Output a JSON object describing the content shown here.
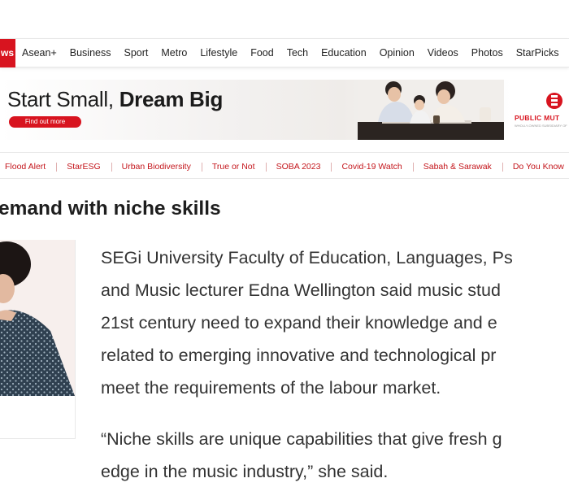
{
  "nav": {
    "logo_text": "ws",
    "items": [
      "Asean+",
      "Business",
      "Sport",
      "Metro",
      "Lifestyle",
      "Food",
      "Tech",
      "Education",
      "Opinion",
      "Videos",
      "Photos",
      "StarPicks"
    ]
  },
  "ad": {
    "headline_part1": "Start Small, ",
    "headline_part2": "Dream Big",
    "cta_label": "Find out more",
    "brand_name": "PUBLIC MUT",
    "brand_tagline": "WHOLLY-OWNED SUBSIDIARY OF",
    "brand_color": "#d8141f"
  },
  "topics": [
    "Flood Alert",
    "StarESG",
    "Urban Biodiversity",
    "True or Not",
    "SOBA 2023",
    "Covid-19 Watch",
    "Sabah & Sarawak",
    "Do You Know"
  ],
  "article": {
    "title": "emand with niche skills",
    "paragraph1": [
      "SEGi University Faculty of Education, Languages, Ps",
      "and Music lecturer Edna Wellington said music stud",
      "21st century need to expand their knowledge and e",
      "related to emerging innovative and technological pr",
      "meet the requirements of the labour market."
    ],
    "paragraph2": [
      "“Niche skills are unique capabilities that give fresh g",
      "edge in the music industry,” she said."
    ]
  },
  "colors": {
    "accent": "#c4161c",
    "text": "#333333"
  }
}
